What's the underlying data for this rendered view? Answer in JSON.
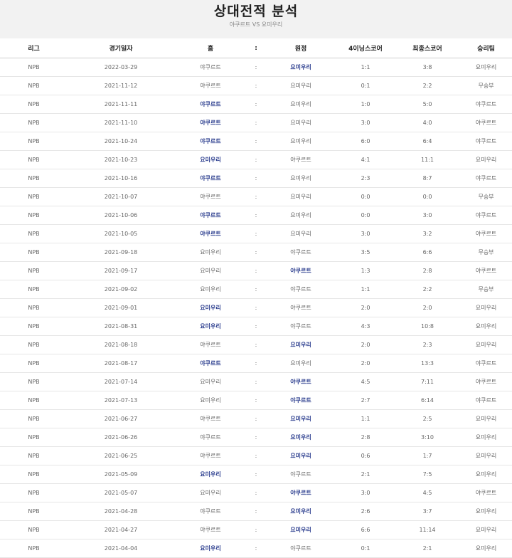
{
  "header": {
    "title": "상대전적 분석",
    "subtitle": "야쿠르트 VS 요미우리"
  },
  "columns": [
    "리그",
    "경기일자",
    "홈",
    ":",
    "원정",
    "4이닝스코어",
    "최종스코어",
    "승리팀"
  ],
  "rows": [
    {
      "league": "NPB",
      "date": "2022-03-29",
      "home": "야쿠르트",
      "sep": ":",
      "away": "요미우리",
      "inning4": "1:1",
      "final": "3:8",
      "winner": "요미우리",
      "win_side": "away"
    },
    {
      "league": "NPB",
      "date": "2021-11-12",
      "home": "야쿠르트",
      "sep": ":",
      "away": "요미우리",
      "inning4": "0:1",
      "final": "2:2",
      "winner": "무승부",
      "win_side": "none"
    },
    {
      "league": "NPB",
      "date": "2021-11-11",
      "home": "야쿠르트",
      "sep": ":",
      "away": "요미우리",
      "inning4": "1:0",
      "final": "5:0",
      "winner": "야쿠르트",
      "win_side": "home"
    },
    {
      "league": "NPB",
      "date": "2021-11-10",
      "home": "야쿠르트",
      "sep": ":",
      "away": "요미우리",
      "inning4": "3:0",
      "final": "4:0",
      "winner": "야쿠르트",
      "win_side": "home"
    },
    {
      "league": "NPB",
      "date": "2021-10-24",
      "home": "야쿠르트",
      "sep": ":",
      "away": "요미우리",
      "inning4": "6:0",
      "final": "6:4",
      "winner": "야쿠르트",
      "win_side": "home"
    },
    {
      "league": "NPB",
      "date": "2021-10-23",
      "home": "요미우리",
      "sep": ":",
      "away": "야쿠르트",
      "inning4": "4:1",
      "final": "11:1",
      "winner": "요미우리",
      "win_side": "home"
    },
    {
      "league": "NPB",
      "date": "2021-10-16",
      "home": "야쿠르트",
      "sep": ":",
      "away": "요미우리",
      "inning4": "2:3",
      "final": "8:7",
      "winner": "야쿠르트",
      "win_side": "home"
    },
    {
      "league": "NPB",
      "date": "2021-10-07",
      "home": "야쿠르트",
      "sep": ":",
      "away": "요미우리",
      "inning4": "0:0",
      "final": "0:0",
      "winner": "무승부",
      "win_side": "none"
    },
    {
      "league": "NPB",
      "date": "2021-10-06",
      "home": "야쿠르트",
      "sep": ":",
      "away": "요미우리",
      "inning4": "0:0",
      "final": "3:0",
      "winner": "야쿠르트",
      "win_side": "home"
    },
    {
      "league": "NPB",
      "date": "2021-10-05",
      "home": "야쿠르트",
      "sep": ":",
      "away": "요미우리",
      "inning4": "3:0",
      "final": "3:2",
      "winner": "야쿠르트",
      "win_side": "home"
    },
    {
      "league": "NPB",
      "date": "2021-09-18",
      "home": "요미우리",
      "sep": ":",
      "away": "야쿠르트",
      "inning4": "3:5",
      "final": "6:6",
      "winner": "무승부",
      "win_side": "none"
    },
    {
      "league": "NPB",
      "date": "2021-09-17",
      "home": "요미우리",
      "sep": ":",
      "away": "야쿠르트",
      "inning4": "1:3",
      "final": "2:8",
      "winner": "야쿠르트",
      "win_side": "away"
    },
    {
      "league": "NPB",
      "date": "2021-09-02",
      "home": "요미우리",
      "sep": ":",
      "away": "야쿠르트",
      "inning4": "1:1",
      "final": "2:2",
      "winner": "무승부",
      "win_side": "none"
    },
    {
      "league": "NPB",
      "date": "2021-09-01",
      "home": "요미우리",
      "sep": ":",
      "away": "야쿠르트",
      "inning4": "2:0",
      "final": "2:0",
      "winner": "요미우리",
      "win_side": "home"
    },
    {
      "league": "NPB",
      "date": "2021-08-31",
      "home": "요미우리",
      "sep": ":",
      "away": "야쿠르트",
      "inning4": "4:3",
      "final": "10:8",
      "winner": "요미우리",
      "win_side": "home"
    },
    {
      "league": "NPB",
      "date": "2021-08-18",
      "home": "야쿠르트",
      "sep": ":",
      "away": "요미우리",
      "inning4": "2:0",
      "final": "2:3",
      "winner": "요미우리",
      "win_side": "away"
    },
    {
      "league": "NPB",
      "date": "2021-08-17",
      "home": "야쿠르트",
      "sep": ":",
      "away": "요미우리",
      "inning4": "2:0",
      "final": "13:3",
      "winner": "야쿠르트",
      "win_side": "home"
    },
    {
      "league": "NPB",
      "date": "2021-07-14",
      "home": "요미우리",
      "sep": ":",
      "away": "야쿠르트",
      "inning4": "4:5",
      "final": "7:11",
      "winner": "야쿠르트",
      "win_side": "away"
    },
    {
      "league": "NPB",
      "date": "2021-07-13",
      "home": "요미우리",
      "sep": ":",
      "away": "야쿠르트",
      "inning4": "2:7",
      "final": "6:14",
      "winner": "야쿠르트",
      "win_side": "away"
    },
    {
      "league": "NPB",
      "date": "2021-06-27",
      "home": "야쿠르트",
      "sep": ":",
      "away": "요미우리",
      "inning4": "1:1",
      "final": "2:5",
      "winner": "요미우리",
      "win_side": "away"
    },
    {
      "league": "NPB",
      "date": "2021-06-26",
      "home": "야쿠르트",
      "sep": ":",
      "away": "요미우리",
      "inning4": "2:8",
      "final": "3:10",
      "winner": "요미우리",
      "win_side": "away"
    },
    {
      "league": "NPB",
      "date": "2021-06-25",
      "home": "야쿠르트",
      "sep": ":",
      "away": "요미우리",
      "inning4": "0:6",
      "final": "1:7",
      "winner": "요미우리",
      "win_side": "away"
    },
    {
      "league": "NPB",
      "date": "2021-05-09",
      "home": "요미우리",
      "sep": ":",
      "away": "야쿠르트",
      "inning4": "2:1",
      "final": "7:5",
      "winner": "요미우리",
      "win_side": "home"
    },
    {
      "league": "NPB",
      "date": "2021-05-07",
      "home": "요미우리",
      "sep": ":",
      "away": "야쿠르트",
      "inning4": "3:0",
      "final": "4:5",
      "winner": "야쿠르트",
      "win_side": "away"
    },
    {
      "league": "NPB",
      "date": "2021-04-28",
      "home": "야쿠르트",
      "sep": ":",
      "away": "요미우리",
      "inning4": "2:6",
      "final": "3:7",
      "winner": "요미우리",
      "win_side": "away"
    },
    {
      "league": "NPB",
      "date": "2021-04-27",
      "home": "야쿠르트",
      "sep": ":",
      "away": "요미우리",
      "inning4": "6:6",
      "final": "11:14",
      "winner": "요미우리",
      "win_side": "away"
    },
    {
      "league": "NPB",
      "date": "2021-04-04",
      "home": "요미우리",
      "sep": ":",
      "away": "야쿠르트",
      "inning4": "0:1",
      "final": "2:1",
      "winner": "요미우리",
      "win_side": "home"
    }
  ]
}
